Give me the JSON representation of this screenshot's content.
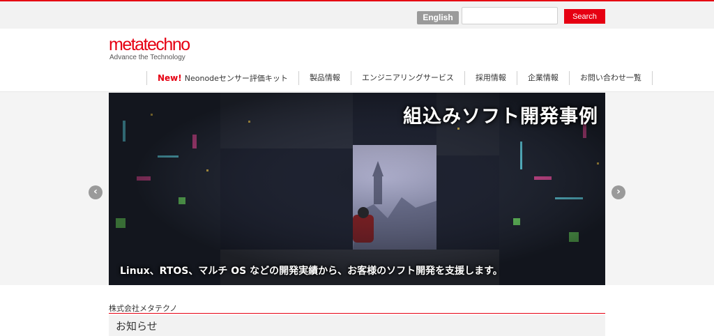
{
  "header": {
    "lang_button": "English",
    "search": {
      "placeholder": "",
      "value": "",
      "button_label": "Search"
    }
  },
  "logo": {
    "name": "metatechno",
    "tagline": "Advance the Technology"
  },
  "nav": {
    "new_badge": "New!",
    "items": [
      "Neonodeセンサー評価キット",
      "製品情報",
      "エンジニアリングサービス",
      "採用情報",
      "企業情報",
      "お問い合わせ一覧"
    ]
  },
  "hero": {
    "title": "組込みソフト開発事例",
    "caption": "Linux、RTOS、マルチ OS などの開発実績から、お客様のソフト開発を支援します。",
    "prev_icon": "chevron-left-icon",
    "next_icon": "chevron-right-icon"
  },
  "footer": {
    "company_name": "株式会社メタテクノ",
    "news_title": "お知らせ"
  },
  "colors": {
    "accent": "#e60012",
    "gray_button": "#9a9a9a",
    "topbar_bg": "#f2f2f2"
  }
}
